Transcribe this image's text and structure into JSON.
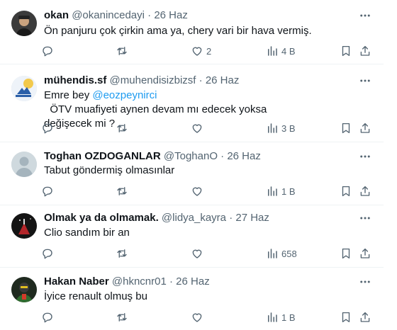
{
  "tweets": [
    {
      "name": "okan",
      "handle": "@okanincedayi",
      "date": "26 Haz",
      "text": "Ön panjuru çok çirkin ama ya, chery vari bir hava vermiş.",
      "likes": "2",
      "views": "4 B"
    },
    {
      "name": "mühendis.sf",
      "handle": "@muhendisizbizsf",
      "date": "26 Haz",
      "text_before": "Emre bey ",
      "mention": "@eozpeynirci",
      "text_after": "  ÖTV muafiyeti aynen devam mı edecek yoksa",
      "text_line2": "değişecek mi ?",
      "views": "3 B"
    },
    {
      "name": "Toghan OZDOGANLAR",
      "handle": "@ToghanO",
      "date": "26 Haz",
      "text": "Tabut göndermiş olmasınlar",
      "views": "1 B"
    },
    {
      "name": "Olmak ya da olmamak.",
      "handle": "@lidya_kayra",
      "date": "27 Haz",
      "text": "Clio sandım bir an",
      "views": "658"
    },
    {
      "name": "Hakan Naber",
      "handle": "@hkncnr01",
      "date": "26 Haz",
      "text": "İyice renault olmuş bu",
      "views": "1 B"
    }
  ],
  "separator": "·",
  "icons": [
    "more-icon",
    "reply-icon",
    "retweet-icon",
    "like-icon",
    "views-icon",
    "bookmark-icon",
    "share-icon"
  ],
  "colors": {
    "text": "#0f1419",
    "muted": "#536471",
    "link": "#1d9bf0",
    "border": "#eff3f4"
  }
}
